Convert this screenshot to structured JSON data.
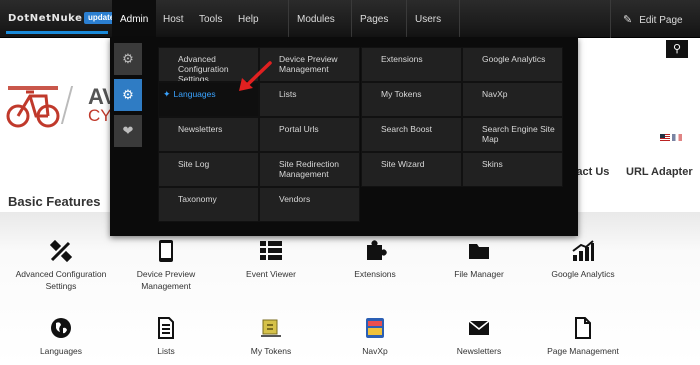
{
  "topbar": {
    "logo_text": "DotNetNuke",
    "update_badge": "update",
    "nav": [
      "Admin",
      "Host",
      "Tools",
      "Help"
    ],
    "dropdowns": [
      "Modules",
      "Pages",
      "Users"
    ],
    "edit_page": "Edit Page"
  },
  "brand": {
    "line1": "AV",
    "line2": "CY"
  },
  "page_nav": [
    "ntact Us",
    "URL Adapter"
  ],
  "admin_menu": {
    "items": [
      "Advanced Configuration Settings",
      "Device Preview Management",
      "Extensions",
      "Google Analytics",
      "Languages",
      "Lists",
      "My Tokens",
      "NavXp",
      "Newsletters",
      "Portal Urls",
      "Search Boost",
      "Search Engine Site Map",
      "Site Log",
      "Site Redirection Management",
      "Site Wizard",
      "Skins",
      "Taxonomy",
      "Vendors"
    ],
    "highlighted": "Languages"
  },
  "features": {
    "title": "Basic Features",
    "row1": [
      {
        "label": "Advanced Configuration Settings",
        "icon": "tools-icon"
      },
      {
        "label": "Device Preview Management",
        "icon": "tablet-icon"
      },
      {
        "label": "Event Viewer",
        "icon": "list-icon"
      },
      {
        "label": "Extensions",
        "icon": "puzzle-icon"
      },
      {
        "label": "File Manager",
        "icon": "folder-icon"
      },
      {
        "label": "Google Analytics",
        "icon": "analytics-icon"
      }
    ],
    "row2": [
      {
        "label": "Languages",
        "icon": "globe-icon"
      },
      {
        "label": "Lists",
        "icon": "document-list-icon"
      },
      {
        "label": "My Tokens",
        "icon": "tokens-icon"
      },
      {
        "label": "NavXp",
        "icon": "navxp-icon"
      },
      {
        "label": "Newsletters",
        "icon": "envelope-icon"
      },
      {
        "label": "Page Management",
        "icon": "page-icon"
      }
    ]
  },
  "colors": {
    "accent": "#2f7cc4",
    "link_highlight": "#3aa3ff",
    "arrow": "#e02020",
    "brand_red": "#c0392b"
  }
}
